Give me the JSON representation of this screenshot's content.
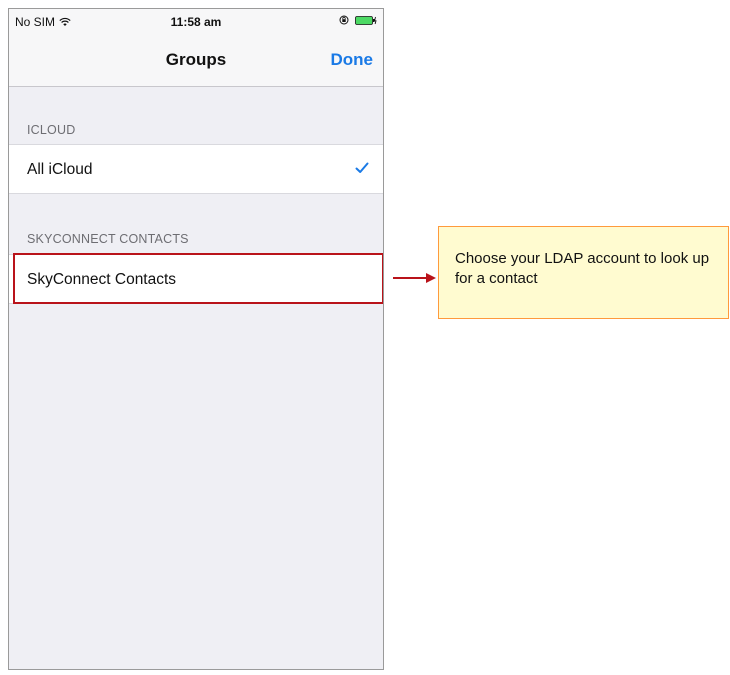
{
  "status_bar": {
    "carrier": "No SIM",
    "time": "11:58 am",
    "icons": [
      "wifi-icon",
      "orientation-lock-icon",
      "battery-charging-icon"
    ]
  },
  "nav_bar": {
    "title": "Groups",
    "done_label": "Done"
  },
  "sections": [
    {
      "header": "ICLOUD",
      "rows": [
        {
          "label": "All iCloud",
          "checked": true
        }
      ]
    },
    {
      "header": "SKYCONNECT CONTACTS",
      "rows": [
        {
          "label": "SkyConnect Contacts",
          "checked": false
        }
      ]
    }
  ],
  "annotation": {
    "text": "Choose your LDAP account to look up for a contact",
    "highlight_color": "#b9131a",
    "callout_fill": "#fffbd0",
    "callout_border": "#ff9a3c"
  },
  "colors": {
    "accent": "#1a7ae6",
    "background": "#efeff4"
  }
}
